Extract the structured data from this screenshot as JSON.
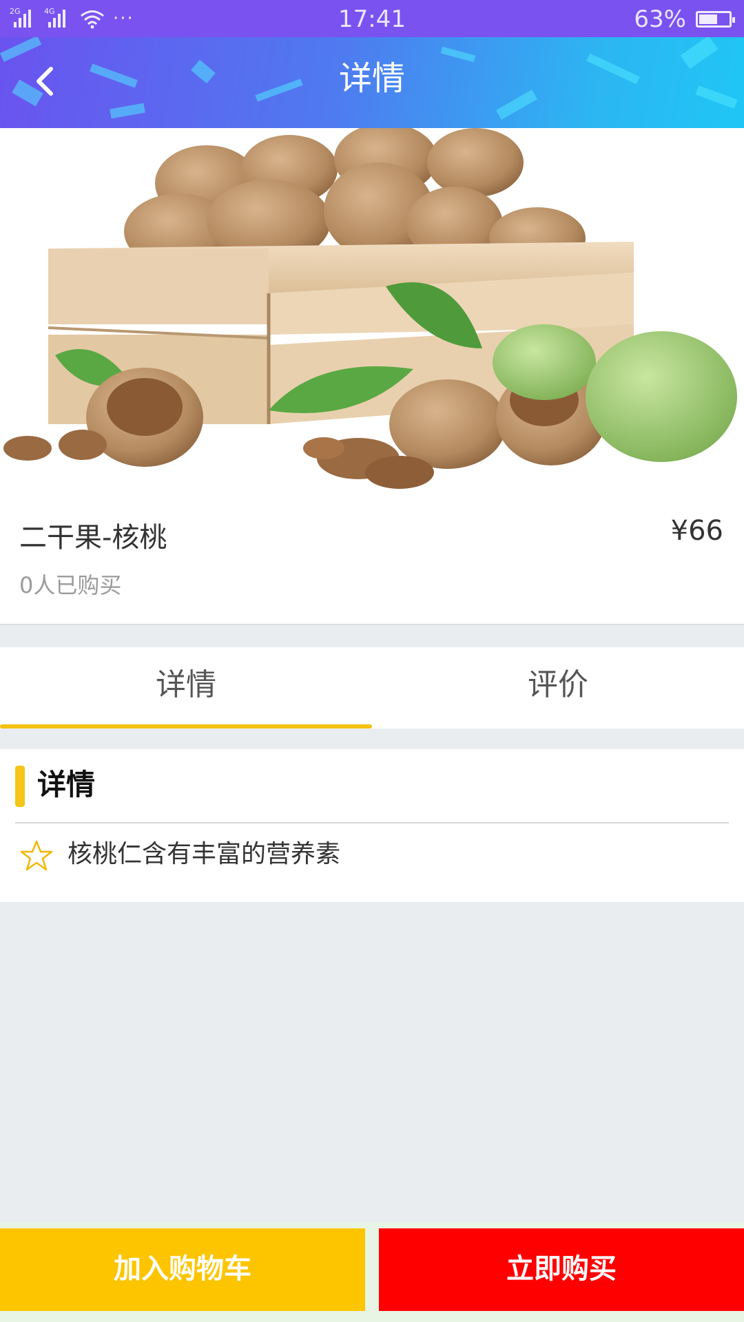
{
  "status_bar": {
    "network_1": "2G",
    "network_2": "4G",
    "dots": "···",
    "time": "17:41",
    "battery": "63%",
    "battery_level": 0.63
  },
  "header": {
    "title": "详情",
    "back_icon": "chevron-left-icon"
  },
  "product": {
    "image_description_icon": "walnut-product-image",
    "name": "二干果-核桃",
    "price": "¥66",
    "buyers": "0人已购买"
  },
  "tabs": [
    {
      "label": "详情",
      "active": true
    },
    {
      "label": "评价",
      "active": false
    }
  ],
  "details": {
    "heading": "详情",
    "items": [
      {
        "icon": "star-outline-icon",
        "text": "核桃仁含有丰富的营养素"
      }
    ]
  },
  "actions": {
    "add_to_cart": "加入购物车",
    "buy_now": "立即购买"
  },
  "colors": {
    "status_bar": "#7a52f0",
    "accent_yellow": "#fcc500",
    "buy_red": "#ff0000",
    "tab_indicator": "#f4c20d"
  }
}
